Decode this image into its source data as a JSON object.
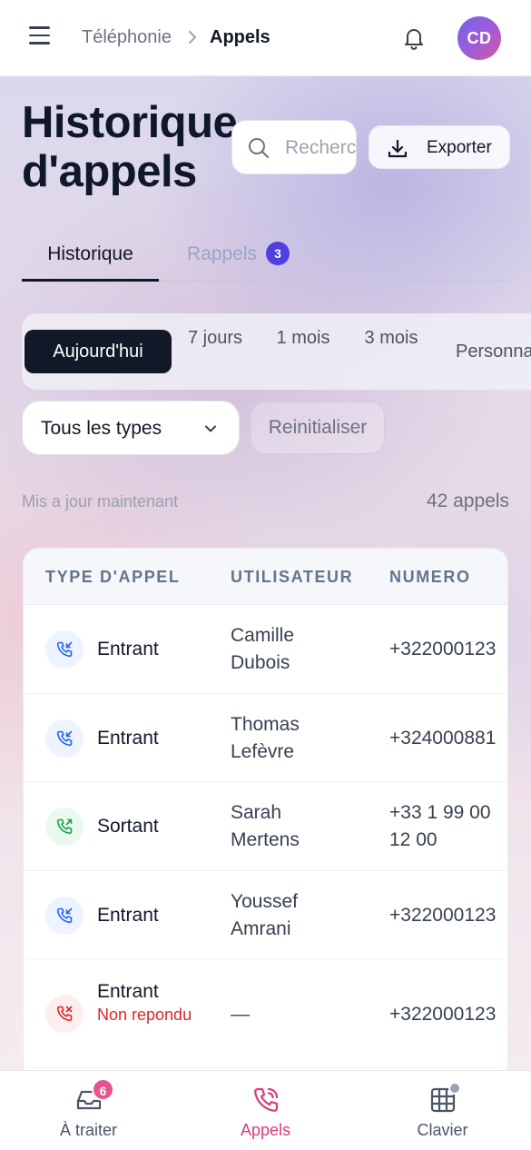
{
  "colors": {
    "accent": "#4f3fe0",
    "active_nav": "#db3a7a",
    "missed": "#dc2626",
    "incoming_icon": "#2563eb",
    "outgoing_icon": "#16a34a",
    "dark_pill": "#111827"
  },
  "header": {
    "menu_icon": "hamburger-menu-icon",
    "breadcrumb_parent": "Téléphonie",
    "breadcrumb_current": "Appels",
    "notification_icon": "bell-icon",
    "avatar_initials": "CD"
  },
  "page": {
    "title": "Historique d'appels",
    "search_placeholder": "Rechercher",
    "export_label": "Exporter"
  },
  "tabs": [
    {
      "label": "Historique",
      "active": true
    },
    {
      "label": "Rappels",
      "badge": "3",
      "active": false
    }
  ],
  "periods": {
    "today": "Aujourd'hui",
    "d7": "7 jours",
    "m1": "1 mois",
    "m3": "3 mois",
    "custom": "Personnalisé"
  },
  "filters": {
    "type_select": "Tous les types",
    "reset": "Reinitialiser"
  },
  "summary": {
    "updated": "Mis a jour maintenant",
    "count": "42 appels"
  },
  "table": {
    "headers": [
      "TYPE D'APPEL",
      "UTILISATEUR",
      "NUMERO"
    ],
    "rows": [
      {
        "type": "Entrant",
        "kind": "incoming",
        "user": "Camille Dubois",
        "number": "+322000123"
      },
      {
        "type": "Entrant",
        "kind": "incoming",
        "user": "Thomas Lefèvre",
        "number": "+324000881"
      },
      {
        "type": "Sortant",
        "kind": "outgoing",
        "user": "Sarah Mertens",
        "number": "+33 1 99 00 12 00"
      },
      {
        "type": "Entrant",
        "kind": "incoming",
        "user": "Youssef Amrani",
        "number": "+322000123"
      },
      {
        "type": "Entrant",
        "status": "Non repondu",
        "kind": "missed",
        "user": "—",
        "number": "+322000123"
      }
    ]
  },
  "bottom_nav": [
    {
      "label": "À traiter",
      "icon": "inbox-icon",
      "badge": "6"
    },
    {
      "label": "Appels",
      "icon": "phone-icon",
      "active": true
    },
    {
      "label": "Clavier",
      "icon": "keypad-grid-icon",
      "dot": true
    }
  ]
}
